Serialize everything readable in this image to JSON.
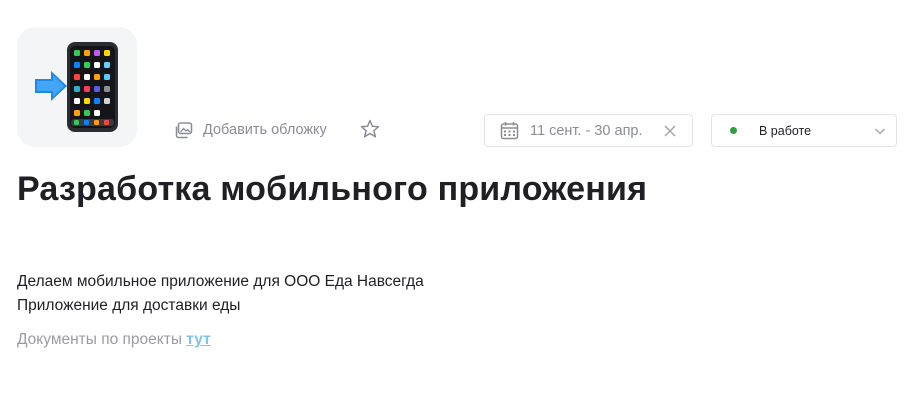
{
  "project": {
    "title": "Разработка мобильного приложения",
    "icon": "mobile-phone-arrow-icon"
  },
  "toolbar": {
    "add_cover_label": "Добавить обложку",
    "favorite_icon": "star-icon"
  },
  "date_range": {
    "value": "11 сент. - 30 апр.",
    "icon": "calendar-icon",
    "clear_icon": "close-icon"
  },
  "status": {
    "value": "В работе",
    "dot_color": "#2ea043",
    "icon": "chevron-down-icon"
  },
  "description": {
    "lines": [
      "Делаем мобильное приложение для ООО Еда Навсегда",
      "Приложение для доставки еды"
    ],
    "docs_text": "Документы по проекты",
    "docs_link_text": "тут"
  },
  "colors": {
    "link": "#7ec3ea",
    "muted": "#8a8d96",
    "title": "#1f1f26",
    "border": "#e3e5ea"
  }
}
